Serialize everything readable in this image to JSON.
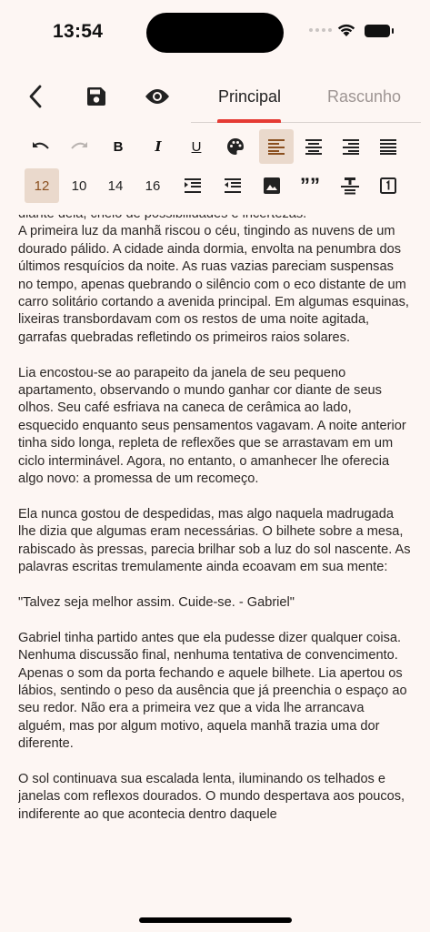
{
  "status_bar": {
    "time": "13:54"
  },
  "header": {
    "tabs": [
      {
        "label": "Principal",
        "active": true
      },
      {
        "label": "Rascunho",
        "active": false
      }
    ],
    "accent_color": "#e53b34"
  },
  "toolbar": {
    "bold_label": "B",
    "italic_label": "I",
    "underline_label": "U",
    "font_sizes": [
      "12",
      "10",
      "14",
      "16"
    ],
    "selected_font_size": "12",
    "active_alignment": "align-left",
    "quote_label": "””"
  },
  "document": {
    "partial_line": "diante dela, cheio de possibilidades e incertezas.",
    "paragraphs": [
      "A primeira luz da manhã riscou o céu, tingindo as nuvens de um dourado pálido. A cidade ainda dormia, envolta na penumbra dos últimos resquícios da noite. As ruas vazias pareciam suspensas no tempo, apenas quebrando o silêncio com o eco distante de um carro solitário cortando a avenida principal. Em algumas esquinas, lixeiras transbordavam com os restos de uma noite agitada, garrafas quebradas refletindo os primeiros raios solares.",
      "Lia encostou-se ao parapeito da janela de seu pequeno apartamento, observando o mundo ganhar cor diante de seus olhos. Seu café esfriava na caneca de cerâmica ao lado, esquecido enquanto seus pensamentos vagavam. A noite anterior tinha sido longa, repleta de reflexões que se arrastavam em um ciclo interminável. Agora, no entanto, o amanhecer lhe oferecia algo novo: a promessa de um recomeço.",
      "Ela nunca gostou de despedidas, mas algo naquela madrugada lhe dizia que algumas eram necessárias. O bilhete sobre a mesa, rabiscado às pressas, parecia brilhar sob a luz do sol nascente. As palavras escritas tremulamente ainda ecoavam em sua mente:",
      "\"Talvez seja melhor assim. Cuide-se. - Gabriel\"",
      "Gabriel tinha partido antes que ela pudesse dizer qualquer coisa. Nenhuma discussão final, nenhuma tentativa de convencimento. Apenas o som da porta fechando e aquele bilhete. Lia apertou os lábios, sentindo o peso da ausência que já preenchia o espaço ao seu redor. Não era a primeira vez que a vida lhe arrancava alguém, mas por algum motivo, aquela manhã trazia uma dor diferente.",
      "O sol continuava sua escalada lenta, iluminando os telhados e janelas com reflexos dourados. O mundo despertava aos poucos, indiferente ao que acontecia dentro daquele"
    ]
  }
}
